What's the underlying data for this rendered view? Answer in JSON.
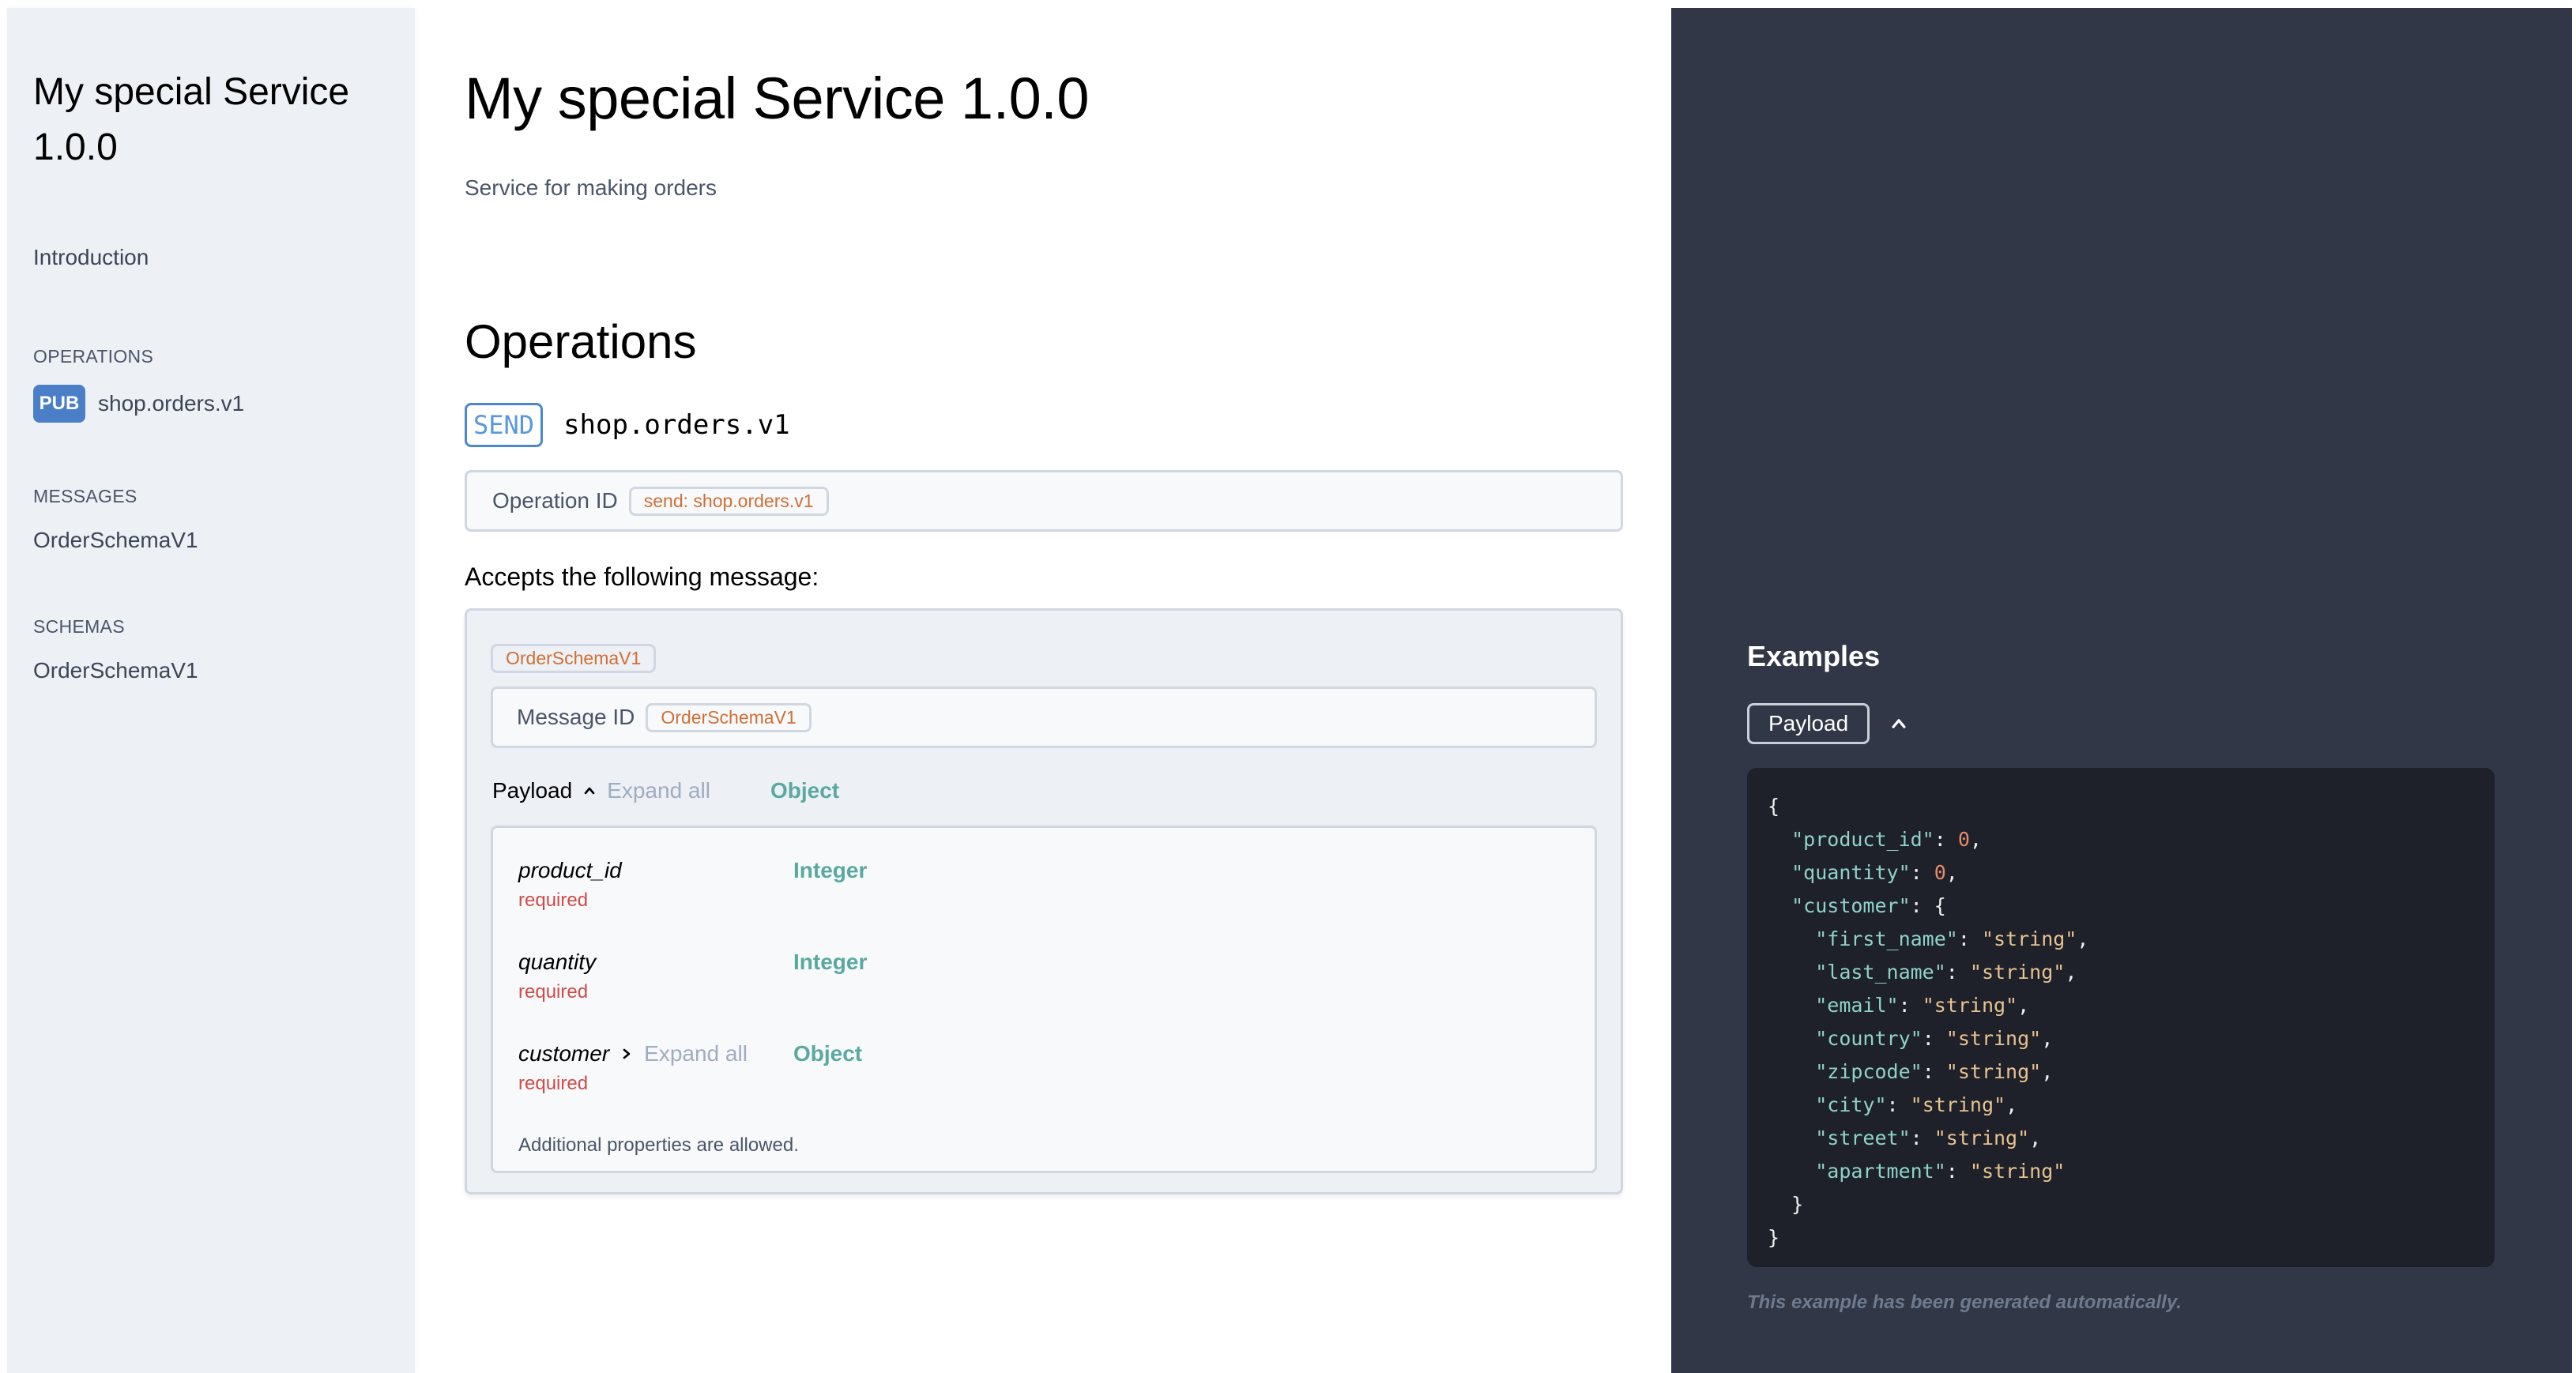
{
  "sidebar": {
    "title": "My special Service 1.0.0",
    "introduction": "Introduction",
    "sections": {
      "operations": {
        "label": "OPERATIONS",
        "items": [
          {
            "badge": "PUB",
            "label": "shop.orders.v1"
          }
        ]
      },
      "messages": {
        "label": "MESSAGES",
        "items": [
          {
            "label": "OrderSchemaV1"
          }
        ]
      },
      "schemas": {
        "label": "SCHEMAS",
        "items": [
          {
            "label": "OrderSchemaV1"
          }
        ]
      }
    }
  },
  "main": {
    "title": "My special Service 1.0.0",
    "description": "Service for making orders",
    "operations_heading": "Operations",
    "operation": {
      "action_badge": "SEND",
      "channel": "shop.orders.v1",
      "operation_id_label": "Operation ID",
      "operation_id_value": "send: shop.orders.v1",
      "accepts_label": "Accepts the following message:",
      "message": {
        "name_tag": "OrderSchemaV1",
        "message_id_label": "Message ID",
        "message_id_value": "OrderSchemaV1",
        "payload_label": "Payload",
        "expand_all": "Expand all",
        "payload_type": "Object",
        "properties": [
          {
            "name": "product_id",
            "required": "required",
            "type": "Integer"
          },
          {
            "name": "quantity",
            "required": "required",
            "type": "Integer"
          },
          {
            "name": "customer",
            "required": "required",
            "type": "Object",
            "expand_all": "Expand all"
          }
        ],
        "additional_properties": "Additional properties are allowed."
      }
    }
  },
  "examples": {
    "heading": "Examples",
    "payload_button": "Payload",
    "code_lines": [
      [
        {
          "t": "p",
          "v": "{"
        }
      ],
      [
        {
          "t": "p",
          "v": "  "
        },
        {
          "t": "k",
          "v": "\"product_id\""
        },
        {
          "t": "p",
          "v": ": "
        },
        {
          "t": "n",
          "v": "0"
        },
        {
          "t": "p",
          "v": ","
        }
      ],
      [
        {
          "t": "p",
          "v": "  "
        },
        {
          "t": "k",
          "v": "\"quantity\""
        },
        {
          "t": "p",
          "v": ": "
        },
        {
          "t": "n",
          "v": "0"
        },
        {
          "t": "p",
          "v": ","
        }
      ],
      [
        {
          "t": "p",
          "v": "  "
        },
        {
          "t": "k",
          "v": "\"customer\""
        },
        {
          "t": "p",
          "v": ": {"
        }
      ],
      [
        {
          "t": "p",
          "v": "    "
        },
        {
          "t": "k",
          "v": "\"first_name\""
        },
        {
          "t": "p",
          "v": ": "
        },
        {
          "t": "s",
          "v": "\"string\""
        },
        {
          "t": "p",
          "v": ","
        }
      ],
      [
        {
          "t": "p",
          "v": "    "
        },
        {
          "t": "k",
          "v": "\"last_name\""
        },
        {
          "t": "p",
          "v": ": "
        },
        {
          "t": "s",
          "v": "\"string\""
        },
        {
          "t": "p",
          "v": ","
        }
      ],
      [
        {
          "t": "p",
          "v": "    "
        },
        {
          "t": "k",
          "v": "\"email\""
        },
        {
          "t": "p",
          "v": ": "
        },
        {
          "t": "s",
          "v": "\"string\""
        },
        {
          "t": "p",
          "v": ","
        }
      ],
      [
        {
          "t": "p",
          "v": "    "
        },
        {
          "t": "k",
          "v": "\"country\""
        },
        {
          "t": "p",
          "v": ": "
        },
        {
          "t": "s",
          "v": "\"string\""
        },
        {
          "t": "p",
          "v": ","
        }
      ],
      [
        {
          "t": "p",
          "v": "    "
        },
        {
          "t": "k",
          "v": "\"zipcode\""
        },
        {
          "t": "p",
          "v": ": "
        },
        {
          "t": "s",
          "v": "\"string\""
        },
        {
          "t": "p",
          "v": ","
        }
      ],
      [
        {
          "t": "p",
          "v": "    "
        },
        {
          "t": "k",
          "v": "\"city\""
        },
        {
          "t": "p",
          "v": ": "
        },
        {
          "t": "s",
          "v": "\"string\""
        },
        {
          "t": "p",
          "v": ","
        }
      ],
      [
        {
          "t": "p",
          "v": "    "
        },
        {
          "t": "k",
          "v": "\"street\""
        },
        {
          "t": "p",
          "v": ": "
        },
        {
          "t": "s",
          "v": "\"string\""
        },
        {
          "t": "p",
          "v": ","
        }
      ],
      [
        {
          "t": "p",
          "v": "    "
        },
        {
          "t": "k",
          "v": "\"apartment\""
        },
        {
          "t": "p",
          "v": ": "
        },
        {
          "t": "s",
          "v": "\"string\""
        }
      ],
      [
        {
          "t": "p",
          "v": "  }"
        }
      ],
      [
        {
          "t": "p",
          "v": "}"
        }
      ]
    ],
    "note": "This example has been generated automatically."
  },
  "colors": {
    "sidebar_bg": "#edf0f5",
    "pub_badge": "#4a7fc8",
    "send_badge": "#4a88d4",
    "tag_text": "#d06f35",
    "type_text": "#5aa9a0",
    "required_text": "#d04a47",
    "examples_bg": "#313747",
    "code_bg": "#1e202a",
    "code_key": "#8fd3c8",
    "code_number": "#e98a68",
    "code_string": "#e8c38f"
  }
}
